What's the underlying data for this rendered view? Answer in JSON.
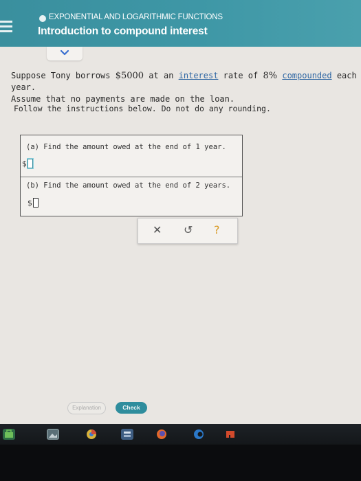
{
  "header": {
    "topic": "EXPONENTIAL AND LOGARITHMIC FUNCTIONS",
    "title": "Introduction to compound interest"
  },
  "problem": {
    "line1_pre": "Suppose Tony borrows ",
    "amount": "$5000",
    "line1_mid": " at an ",
    "link_interest": "interest",
    "line1_mid2": " rate of ",
    "rate": "8%",
    "line1_space": " ",
    "link_compounded": "compounded",
    "line1_post": " each year.",
    "line2": "Assume that no payments are made on the loan.",
    "instructions": "Follow the instructions below. Do not do any rounding."
  },
  "questions": {
    "a": {
      "text": "(a) Find the amount owed at the end of 1 year.",
      "prefix": "$"
    },
    "b": {
      "text": "(b) Find the amount owed at the end of 2 years.",
      "prefix": "$"
    }
  },
  "toolbar": {
    "clear_glyph": "✕",
    "undo_glyph": "↺",
    "help_glyph": "?"
  },
  "footer": {
    "explanation_label": "Explanation",
    "check_label": "Check"
  },
  "colors": {
    "header": "#3e97a6",
    "link": "#3067a3",
    "check_button": "#2f8d9d",
    "help": "#d89a24"
  },
  "taskbar": {
    "icons": [
      "store-icon",
      "photos-icon",
      "chrome-icon",
      "calculator-icon",
      "firefox-icon",
      "edge-icon",
      "office-icon"
    ]
  }
}
